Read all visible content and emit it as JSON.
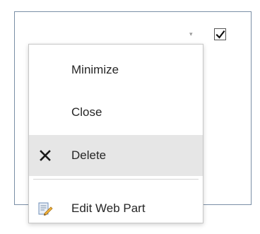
{
  "menu": {
    "items": [
      {
        "label": "Minimize",
        "icon": ""
      },
      {
        "label": "Close",
        "icon": ""
      },
      {
        "label": "Delete",
        "icon": "close-x-icon",
        "highlighted": true
      },
      {
        "label": "Edit Web Part",
        "icon": "edit-web-part-icon"
      }
    ]
  },
  "webpart": {
    "checkbox_checked": true
  },
  "colors": {
    "frame_border": "#7a8fa6",
    "menu_border": "#c6c6c6",
    "highlight": "#e6e6e6",
    "text": "#262626"
  }
}
